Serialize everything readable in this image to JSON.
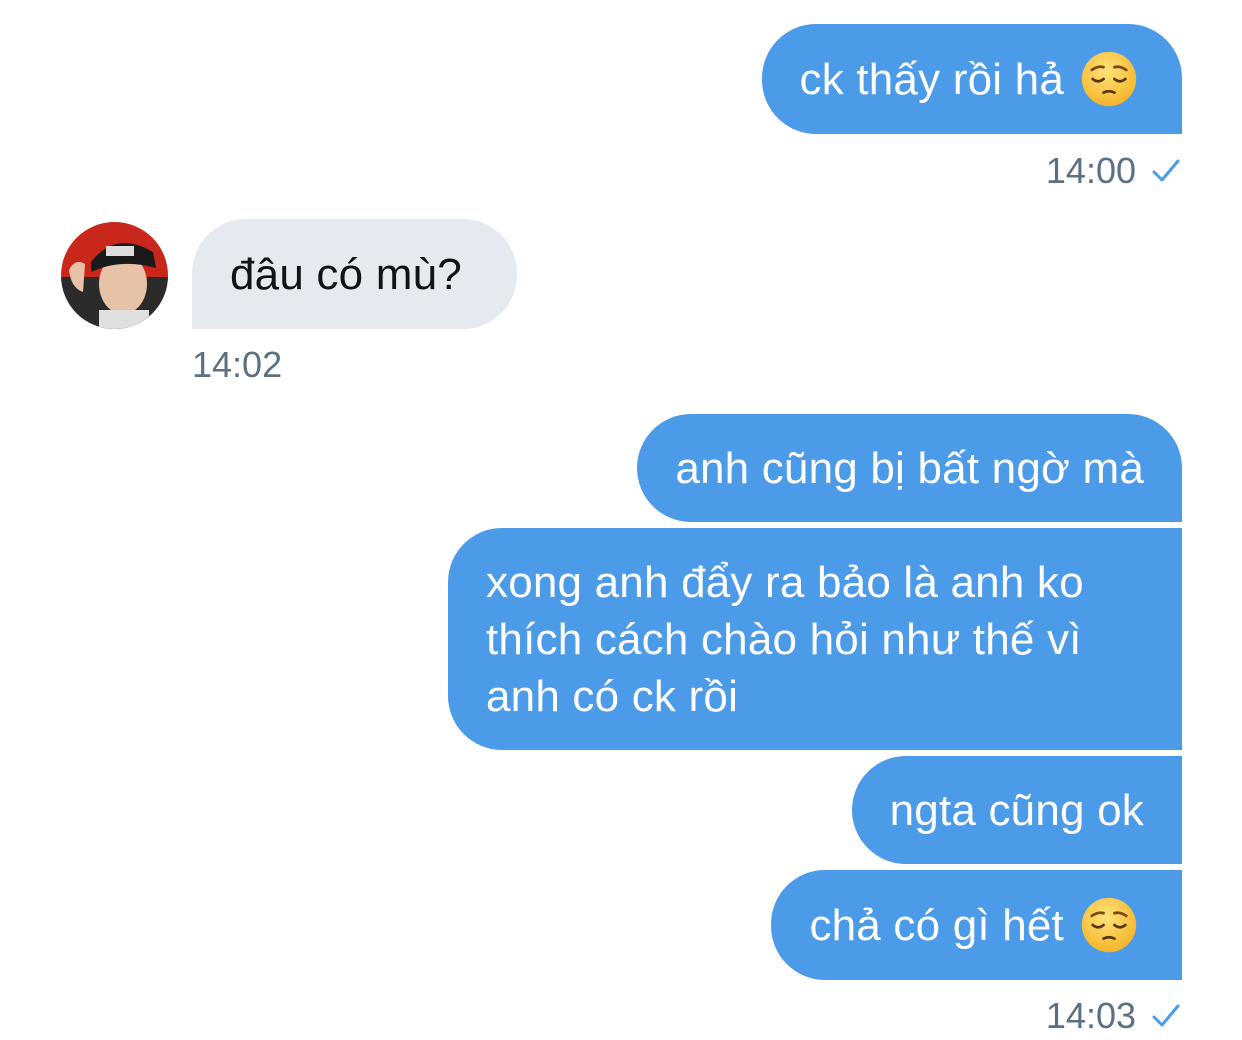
{
  "conversation": {
    "messages": [
      {
        "direction": "outgoing",
        "text": "ck thấy rồi hả",
        "emoji": "pensive-face"
      },
      {
        "direction": "incoming",
        "text": "đâu có mù?"
      },
      {
        "direction": "outgoing",
        "text": "anh cũng bị bất ngờ mà"
      },
      {
        "direction": "outgoing",
        "text": "xong anh đẩy ra bảo là anh ko\nthích cách chào hỏi như thế vì\nanh có ck rồi"
      },
      {
        "direction": "outgoing",
        "text": "ngta cũng ok"
      },
      {
        "direction": "outgoing",
        "text": "chả có gì hết",
        "emoji": "pensive-face"
      }
    ],
    "timestamps": {
      "first_out": "14:00",
      "incoming": "14:02",
      "last_out": "14:03"
    },
    "read_status_icon": "checkmark-icon",
    "avatar_icon": "contact-avatar"
  },
  "colors": {
    "outgoing_bubble": "#4c9be8",
    "incoming_bubble": "#e6e9ef",
    "timestamp": "#5b7083",
    "checkmark": "#4c9be8"
  }
}
